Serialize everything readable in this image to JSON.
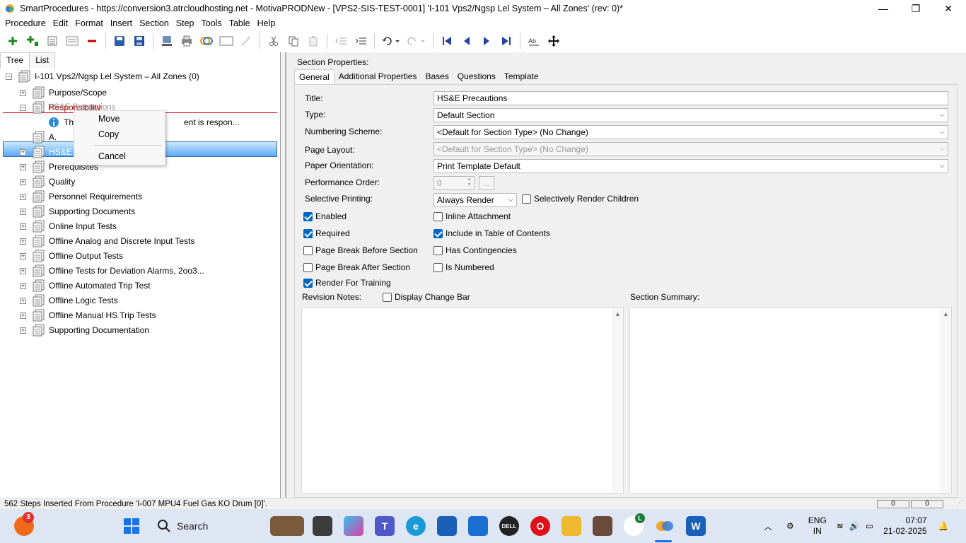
{
  "window": {
    "title": "SmartProcedures - https://conversion3.atrcloudhosting.net - MotivaPRODNew - [VPS2-SIS-TEST-0001] 'I-101 Vps2/Ngsp Lel System – All Zones' (rev: 0)*",
    "minimize": "—",
    "maximize": "❐",
    "close": "✕"
  },
  "menu": [
    "Procedure",
    "Edit",
    "Format",
    "Insert",
    "Section",
    "Step",
    "Tools",
    "Table",
    "Help"
  ],
  "left_tabs": [
    "Tree",
    "List"
  ],
  "tree": {
    "root": "I-101 Vps2/Ngsp Lel System – All Zones (0)",
    "items": [
      {
        "label": "Purpose/Scope",
        "expander": "+"
      },
      {
        "label": "Responsibility",
        "expander": "−"
      },
      {
        "label": "The ... is respon...",
        "prefix": "Th",
        "suffix": "ent is respon..."
      },
      {
        "label": "A."
      },
      {
        "label": "HS&E P",
        "expander": "+"
      },
      {
        "label": "Prerequisites",
        "expander": "+"
      },
      {
        "label": "Quality",
        "expander": "+"
      },
      {
        "label": "Personnel Requirements",
        "expander": "+"
      },
      {
        "label": "Supporting Documents",
        "expander": "+"
      },
      {
        "label": "Online Input Tests",
        "expander": "+"
      },
      {
        "label": "Offline Analog and Discrete Input Tests",
        "expander": "+"
      },
      {
        "label": "Offline Output Tests",
        "expander": "+"
      },
      {
        "label": "Offline Tests for Deviation Alarms, 2oo3...",
        "expander": "+"
      },
      {
        "label": "Offline Automated Trip Test",
        "expander": "+"
      },
      {
        "label": "Offline Logic Tests",
        "expander": "+"
      },
      {
        "label": "Offline Manual HS Trip Tests",
        "expander": "+"
      },
      {
        "label": "Supporting Documentation",
        "expander": "+"
      }
    ],
    "drag_ghost": "HS&E Precautions"
  },
  "context_menu": {
    "move": "Move",
    "copy": "Copy",
    "cancel": "Cancel"
  },
  "right": {
    "header": "Section Properties:",
    "tabs": [
      "General",
      "Additional Properties",
      "Bases",
      "Questions",
      "Template"
    ],
    "labels": {
      "title": "Title:",
      "type": "Type:",
      "numbering": "Numbering Scheme:",
      "page_layout": "Page Layout:",
      "paper_orientation": "Paper Orientation:",
      "performance_order": "Performance Order:",
      "selective_printing": "Selective Printing:",
      "revision_notes": "Revision Notes:",
      "section_summary": "Section Summary:"
    },
    "values": {
      "title": "HS&E Precautions",
      "type": "Default Section",
      "numbering": "<Default for Section Type> (No Change)",
      "page_layout": "<Default for Section Type> (No Change)",
      "paper_orientation": "Print Template Default",
      "performance_order": "0",
      "selective_printing": "Always Render",
      "ellipsis": "..."
    },
    "checkboxes": {
      "selectively_render_children": {
        "label": "Selectively Render Children",
        "checked": false
      },
      "enabled": {
        "label": "Enabled",
        "checked": true
      },
      "inline_attachment": {
        "label": "Inline Attachment",
        "checked": false
      },
      "required": {
        "label": "Required",
        "checked": true
      },
      "include_toc": {
        "label": "Include in Table of Contents",
        "checked": true
      },
      "page_break_before": {
        "label": "Page Break Before Section",
        "checked": false
      },
      "has_contingencies": {
        "label": "Has Contingencies",
        "checked": false
      },
      "page_break_after": {
        "label": "Page Break After Section",
        "checked": false
      },
      "is_numbered": {
        "label": "Is Numbered",
        "checked": false
      },
      "render_for_training": {
        "label": "Render For Training",
        "checked": true
      },
      "display_change_bar": {
        "label": "Display Change Bar",
        "checked": false
      }
    }
  },
  "status": {
    "message": "562 Steps Inserted From Procedure 'I-007 MPU4 Fuel Gas KO Drum [0]'.",
    "box1": "0",
    "box2": "0"
  },
  "taskbar": {
    "search": "Search",
    "notification_count": "3",
    "lang1": "ENG",
    "lang2": "IN",
    "time": "07:07",
    "date": "21-02-2025",
    "chrome_badge": "L"
  },
  "colors": {
    "selection": "#5aaaf5",
    "checkbox_on": "#0067c0",
    "drop_line": "#cc0000"
  }
}
